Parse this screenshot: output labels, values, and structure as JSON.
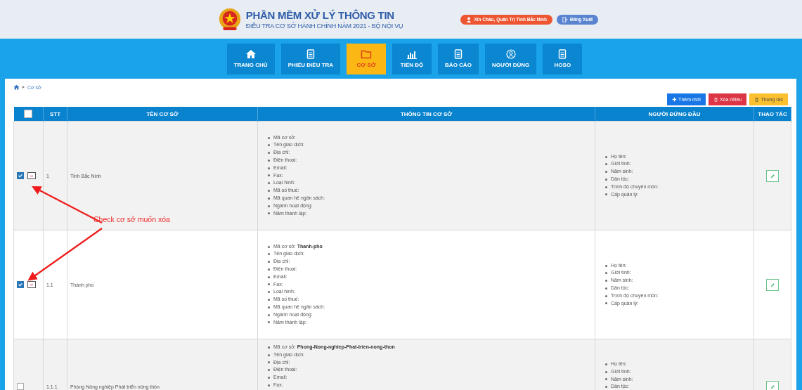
{
  "header": {
    "title": "PHẦN MỀM XỬ LÝ THÔNG TIN",
    "subtitle": "ĐIỀU TRA CƠ SỞ HÀNH CHÍNH NĂM 2021 - BỘ NỘI VỤ",
    "greeting": "Xin Chào, Quản Trị Tỉnh Bắc Ninh",
    "logout": "Đăng Xuất"
  },
  "nav": [
    {
      "label": "TRANG CHỦ",
      "selected": false
    },
    {
      "label": "PHIẾU ĐIỀU TRA",
      "selected": false
    },
    {
      "label": "CƠ SỞ",
      "selected": true
    },
    {
      "label": "TIẾN ĐỘ",
      "selected": false
    },
    {
      "label": "BÁO CÁO",
      "selected": false
    },
    {
      "label": "NGƯỜI DÙNG",
      "selected": false
    },
    {
      "label": "HOSO",
      "selected": false
    }
  ],
  "breadcrumb": "Cơ sở",
  "actions": [
    {
      "label": "Thêm mới",
      "kind": "add"
    },
    {
      "label": "Xóa nhiều",
      "kind": "delete"
    },
    {
      "label": "Thùng rác",
      "kind": "trash"
    }
  ],
  "table": {
    "columns": [
      "STT",
      "TÊN CƠ SỞ",
      "THÔNG TIN CƠ SỞ",
      "NGƯỜI ĐỨNG ĐẦU",
      "THAO TÁC"
    ],
    "header_checked": false,
    "rows": [
      {
        "checked": true,
        "collapse_button": true,
        "stt": "1",
        "name": "Tỉnh Bắc Ninh",
        "info": [
          "Mã cơ sở:",
          "Tên giao dịch:",
          "Địa chỉ:",
          "Điện thoại:",
          "Email:",
          "Fax:",
          "Loại hình:",
          "Mã số thuế:",
          "Mã quan hệ ngân sách:",
          "Ngành hoạt động:",
          "Năm thành lập:"
        ],
        "leader": [
          "Họ tên:",
          "Giới tính:",
          "Năm sinh:",
          "Dân tộc:",
          "Trình độ chuyên môn:",
          "Cấp quản lý:"
        ]
      },
      {
        "checked": true,
        "collapse_button": true,
        "stt": "1.1",
        "name": "Thành phố",
        "info": [
          "Mã cơ sở: **Thanh-pho**",
          "Tên giao dịch:",
          "Địa chỉ:",
          "Điện thoại:",
          "Email:",
          "Fax:",
          "Loại hình:",
          "Mã số thuế:",
          "Mã quan hệ ngân sách:",
          "Ngành hoạt động:",
          "Năm thành lập:"
        ],
        "leader": [
          "Họ tên:",
          "Giới tính:",
          "Năm sinh:",
          "Dân tộc:",
          "Trình độ chuyên môn:",
          "Cấp quản lý:"
        ]
      },
      {
        "checked": false,
        "collapse_button": false,
        "stt": "1.1.1",
        "name": "Phòng Nông nghiệp Phát triển nông thôn",
        "info": [
          "Mã cơ sở: **Phong-Nong-nghiep-Phat-trien-nong-thon**",
          "Tên giao dịch:",
          "Địa chỉ:",
          "Điện thoại:",
          "Email:",
          "Fax:"
        ],
        "leader": [
          "Họ tên:",
          "Giới tính:",
          "Năm sinh:",
          "Dân tộc:"
        ]
      }
    ]
  },
  "annotation": {
    "text": "Check cơ sở muốn xóa"
  }
}
